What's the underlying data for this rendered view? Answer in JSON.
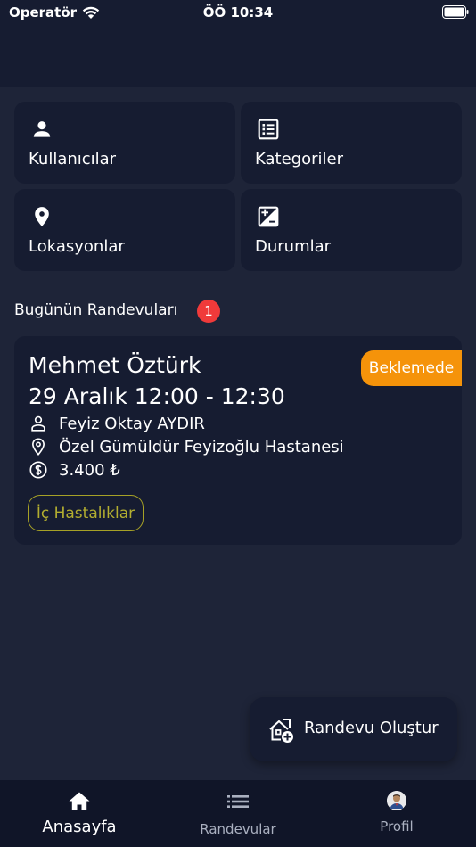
{
  "status_bar": {
    "carrier": "Operatör",
    "time": "ÖÖ 10:34"
  },
  "tiles": [
    {
      "label": "Kullanıcılar",
      "icon": "person-icon"
    },
    {
      "label": "Kategoriler",
      "icon": "list-icon"
    },
    {
      "label": "Lokasyonlar",
      "icon": "location-pin-icon"
    },
    {
      "label": "Durumlar",
      "icon": "exposure-icon"
    }
  ],
  "today": {
    "title": "Bugünün Randevuları",
    "count": "1"
  },
  "appointment": {
    "name": "Mehmet Öztürk",
    "time": "29 Aralık 12:00 - 12:30",
    "status": "Beklemede",
    "doctor": "Feyiz Oktay AYDIR",
    "hospital": "Özel Gümüldür Feyizoğlu Hastanesi",
    "price": "3.400 ₺",
    "category": "İç Hastalıklar"
  },
  "fab": {
    "label": "Randevu Oluştur",
    "icon": "add-home-icon"
  },
  "tabbar": {
    "home": "Anasayfa",
    "appointments": "Randevular",
    "profile": "Profil"
  },
  "colors": {
    "background": "#1e2438",
    "card": "#161c31",
    "status_pending": "#f5930a",
    "badge": "#f03a3a",
    "chip": "#b3ae30"
  }
}
